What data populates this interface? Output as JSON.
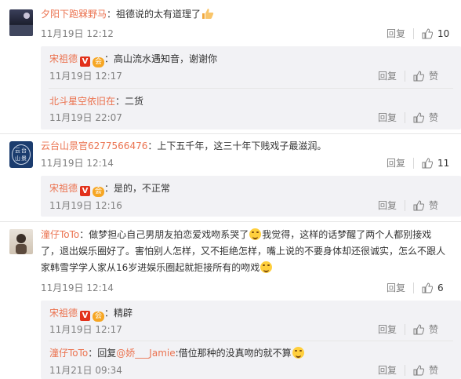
{
  "actions": {
    "reply": "回复",
    "like": "赞"
  },
  "comments": [
    {
      "user": "夕阳下跑槑野马",
      "text": "：祖德说的太有道理了",
      "time": "11月19日 12:12",
      "likes": "10",
      "replies": [
        {
          "user": "宋祖德",
          "text": "：高山流水遇知音，谢谢你",
          "time": "11月19日 12:17"
        },
        {
          "user": "北斗星空依旧在",
          "text": "：二货",
          "time": "11月19日 22:07"
        }
      ]
    },
    {
      "user": "云台山景官6277566476",
      "text": "：上下五千年，这三十年下贱戏子最滋润。",
      "time": "11月19日 12:14",
      "likes": "11",
      "avatar_text": "云台山景",
      "replies": [
        {
          "user": "宋祖德",
          "text": "：是的，不正常",
          "time": "11月19日 12:16"
        }
      ]
    },
    {
      "user": "潼仔ToTo",
      "text_line1": "：做梦担心自己男朋友拍恋爱戏吻系哭了",
      "text_line1b": "我觉得，这样的话梦醒了两个人都别接戏",
      "text_line2": "了，退出娱乐圈好了。害怕别人怎样，又不拒绝怎样，嘴上说的不要身体却还很诚实，怎么不跟人",
      "text_line3": "家韩雪学学人家从16岁进娱乐圈起就拒接所有的吻戏",
      "time": "11月19日 12:14",
      "likes": "6",
      "replies": [
        {
          "user": "宋祖德",
          "text": "：精辟",
          "time": "11月19日 12:17"
        },
        {
          "user": "潼仔ToTo",
          "text_prefix": "：回复",
          "mention": "@娇___Jamie",
          "text": ":借位那种的没真吻的就不算",
          "time": "11月21日 09:34"
        }
      ]
    }
  ]
}
